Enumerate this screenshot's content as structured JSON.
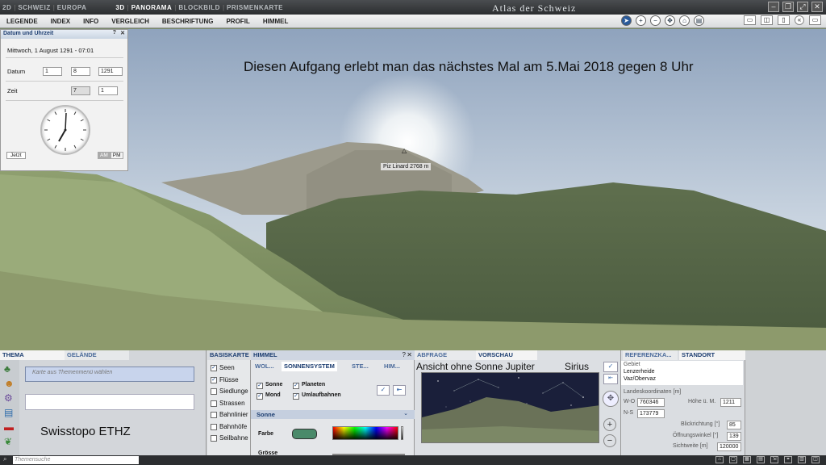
{
  "topbar": {
    "modes2d": [
      "2D",
      "SCHWEIZ",
      "EUROPA"
    ],
    "modes3d": [
      "3D",
      "PANORAMA",
      "BLOCKBILD",
      "PRISMENKARTE"
    ],
    "title": "Atlas der Schweiz"
  },
  "menu": [
    "LEGENDE",
    "INDEX",
    "INFO",
    "VERGLEICH",
    "BESCHRIFTUNG",
    "PROFIL",
    "HIMMEL"
  ],
  "scene": {
    "headline": "Diesen Aufgang erlebt man das nächstes Mal am 5.Mai 2018 gegen 8 Uhr",
    "peak_label": "Piz Linard   2768 m"
  },
  "datetime_dialog": {
    "title": "Datum und Uhrzeit",
    "datetime_text": "Mittwoch, 1 August 1291 - 07:01",
    "date_label": "Datum",
    "date_day": "1",
    "date_month": "8",
    "date_year": "1291",
    "time_label": "Zeit",
    "time_hour": "7",
    "time_minute": "1",
    "now_button": "Jetzt",
    "am": "AM",
    "pm": "PM"
  },
  "theme_panel": {
    "tab_thema": "THEMA",
    "tab_gelaende": "GELÄNDE",
    "placeholder": "Karte aus Themenmenü wählen",
    "caption": "Swisstopo ETHZ"
  },
  "basiskarte": {
    "tab": "BASISKARTE",
    "items": [
      {
        "label": "Seen",
        "checked": true
      },
      {
        "label": "Flüsse",
        "checked": true
      },
      {
        "label": "Siedlunge",
        "checked": false
      },
      {
        "label": "Strassen",
        "checked": false
      },
      {
        "label": "Bahnlinier",
        "checked": false
      },
      {
        "label": "Bahnhöfe",
        "checked": false
      },
      {
        "label": "Seilbahne",
        "checked": false
      }
    ]
  },
  "himmel": {
    "tab": "HIMMEL",
    "subtabs": [
      "WOL...",
      "SONNENSYSTEM",
      "STE...",
      "HIM..."
    ],
    "checks": [
      {
        "label": "Sonne",
        "checked": true
      },
      {
        "label": "Planeten",
        "checked": true
      },
      {
        "label": "Mond",
        "checked": true
      },
      {
        "label": "Umlaufbahnen",
        "checked": true
      }
    ],
    "section": "Sonne",
    "farbe_label": "Farbe",
    "groesse_label": "Grösse",
    "sun_color": "#4a8a6a"
  },
  "preview": {
    "tab_abfrage": "ABFRAGE",
    "tab_vorschau": "VORSCHAU",
    "caption_left": "Ansicht ohne Sonne Jupiter",
    "caption_right": "Sirius"
  },
  "standort": {
    "tab_ref": "REFERENZKA...",
    "tab_standort": "STANDORT",
    "gebiet_label": "Gebiet",
    "gebiet_values": [
      "Lenzerheide",
      "Vaz/Obervaz"
    ],
    "coords_label": "Landeskoordinaten [m]",
    "wo_label": "W-O",
    "wo_value": "760346",
    "ns_label": "N-S",
    "ns_value": "173779",
    "hoehe_label": "Höhe ü. M.",
    "hoehe_value": "1211",
    "blick_label": "Blickrichtung [°]",
    "blick_value": "85",
    "oeffnung_label": "Öffnungswinkel [°]",
    "oeffnung_value": "139",
    "sicht_label": "Sichtweite [m]",
    "sicht_value": "120000"
  },
  "statusbar": {
    "search_placeholder": "Themensuche"
  }
}
